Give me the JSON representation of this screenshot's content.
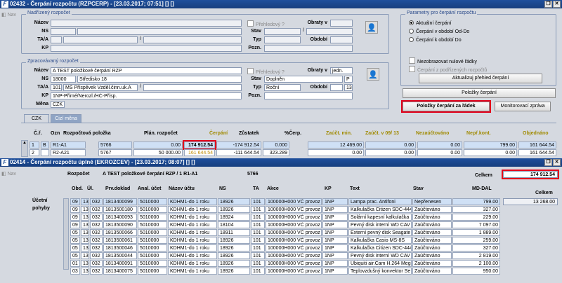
{
  "win1": {
    "title": "02432 - Čerpání rozpočtu (RZPCERP) - [23.03.2017; 07:51] [] []",
    "nav": "Nav"
  },
  "nadrizeny": {
    "title": "Nadřízený rozpočet",
    "nazev": "Název",
    "ns": "NS",
    "taa": "TA/A",
    "kp": "KP",
    "slash": "/",
    "prehledovy": "Přehledový ?",
    "obraty": "Obraty v",
    "stav": "Stav",
    "typ": "Typ",
    "obdobi": "Období",
    "pozn": "Pozn."
  },
  "params": {
    "title": "Parametry pro čerpání rozpočtu",
    "r1": "Aktuální čerpání",
    "r2": "Čerpání v období Od-Do",
    "r3": "Čerpání k období Do",
    "c1": "Nezobrazovat nulové řádky",
    "c2": "Čerpání z podřízených rozpočtů",
    "btn": "Aktualizuj přehled čerpání"
  },
  "zprac": {
    "title": "Zpracovávaný rozpočet",
    "nazev": "Název",
    "nazev_val": "A TEST položkové čerpání RZP",
    "ns": "NS",
    "ns1": "18000",
    "ns2": "Středisko 18",
    "taa": "TA/A",
    "ta1": "101",
    "ta2": "MŠ Příspěvek Vzděl.činn.uk.A",
    "kp": "KP",
    "kp_val": "1NP-Přímé/Nerozl./HČ-Přísp.",
    "mena": "Měna",
    "mena_val": "CZK",
    "prehledovy": "Přehledový ?",
    "obraty": "Obraty v",
    "obraty_val": "jedn.",
    "stav": "Stav",
    "stav_val": "Doplněn",
    "stav_p": "P",
    "typ": "Typ",
    "typ_val": "Roční",
    "obdobi": "Období",
    "obd_val": "13",
    "pozn": "Pozn."
  },
  "buttons": {
    "polozky": "Položky čerpání",
    "zaradek": "Položky čerpání za řádek",
    "monitor": "Monitorovací zpráva"
  },
  "tabs": [
    "CZK",
    "Cizí měna"
  ],
  "grid": {
    "headers": [
      "Č.ř.",
      "Ozn",
      "Rozpočtová položka",
      "Plán. rozpočet",
      "Čerpání",
      "Zůstatek",
      "%Čerp.",
      "Zaúčt. min.",
      "Zaúčt. v 09/ 13",
      "Nezaúčtováno",
      "Nepř.kont.",
      "Objednáno"
    ],
    "rows": [
      [
        "1",
        "B",
        "R1-A1",
        "5766",
        "0.00",
        "174 912.54",
        "-174 912.54",
        "0.000",
        "12 469.00",
        "0.00",
        "0.00",
        "799.00",
        "161 644.54"
      ],
      [
        "2",
        "",
        "R2-A21",
        "5767",
        "50 000.00",
        "161 644.54",
        "-111 644.54",
        "323.289",
        "0.00",
        "0.00",
        "0.00",
        "0.00",
        "161 644.54"
      ]
    ]
  },
  "win2": {
    "title": "02414 - Čerpání rozpočtu úplné (EKROZCEV) - [23.03.2017; 08:07] [] []",
    "nav": "Nav"
  },
  "detail": {
    "rozpocet": "Rozpočet",
    "rozpocet_val": "A TEST položkové čerpání RZP / 1 R1-A1",
    "rozpocet_num": "5766",
    "celkem": "Celkem",
    "celkem_val": "174 912.54",
    "ucetni": "Účetní",
    "pohyby": "pohyby",
    "celkem2": "Celkem",
    "celkem2_val": "13 268.00",
    "headers": [
      "Obd.",
      "Úl.",
      "Prv.doklad",
      "Anal. účet",
      "Název účtu",
      "NS",
      "TA",
      "Akce",
      "KP",
      "Text",
      "Stav",
      "MD-DAL"
    ],
    "rows": [
      [
        "09",
        "13",
        "032",
        "1813400099",
        "5010000",
        "KDHM1-do 1 roku",
        "18926",
        "101",
        "100000H000 VČ provoz",
        "1NP",
        "Lampa prac. Antifoni",
        "Nepřenesen",
        "799.00"
      ],
      [
        "09",
        "13",
        "032",
        "1813500180",
        "5010000",
        "KDHM1-do 1 roku",
        "18926",
        "101",
        "100000H000 VČ provoz",
        "1NP",
        "Kalkulačka Citizen SDC-444",
        "Zaúčtováno",
        "327.00"
      ],
      [
        "09",
        "13",
        "032",
        "1813400093",
        "5010000",
        "KDHM1-do 1 roku",
        "18924",
        "101",
        "100000H000 VČ provoz",
        "1NP",
        "Solární kapesní kalkulačka",
        "Zaúčtováno",
        "229.00"
      ],
      [
        "09",
        "13",
        "032",
        "1813500090",
        "5010000",
        "KDHM1-do 1 roku",
        "18104",
        "101",
        "100000H000 VČ provoz",
        "1NP",
        "Pevný disk interní WD CAV",
        "Zaúčtováno",
        "7 097.00"
      ],
      [
        "05",
        "13",
        "032",
        "1813500066",
        "5010000",
        "KDHM1-do 1 roku",
        "18911",
        "101",
        "100000H000 VČ provoz",
        "1NP",
        "Externí pevný disk Seagate",
        "Zaúčtováno",
        "1 889.00"
      ],
      [
        "05",
        "13",
        "032",
        "1813500061",
        "5010000",
        "KDHM1-do 1 roku",
        "18926",
        "101",
        "100000H000 VČ provoz",
        "1NP",
        "Kalkulačka Casio MS-8S",
        "Zaúčtováno",
        "259.00"
      ],
      [
        "05",
        "13",
        "032",
        "1813500046",
        "5010000",
        "KDHM1-do 1 roku",
        "18926",
        "101",
        "100000H000 VČ provoz",
        "1NP",
        "Kalkulačka Citizen SDC-444",
        "Zaúčtováno",
        "327.00"
      ],
      [
        "05",
        "13",
        "032",
        "1813500044",
        "5010000",
        "KDHM1-do 1 roku",
        "18926",
        "101",
        "100000H000 VČ provoz",
        "1NP",
        "Pevný disk interní WD CAV",
        "Zaúčtováno",
        "2 819.00"
      ],
      [
        "01",
        "13",
        "032",
        "1813400091",
        "5010000",
        "KDHM1-do 1 roku",
        "18926",
        "101",
        "100000H000 VČ provoz",
        "1NP",
        "Ubiquiti air.Cam H.264 Mega",
        "Zaúčtováno",
        "2 100.00"
      ],
      [
        "03",
        "13",
        "032",
        "1813400075",
        "5010000",
        "KDHM1-do 1 roku",
        "18926",
        "101",
        "100000H000 VČ provoz",
        "1NP",
        "Teplovzdušný konvektor Se",
        "Zaúčtováno",
        "950.00"
      ]
    ]
  }
}
